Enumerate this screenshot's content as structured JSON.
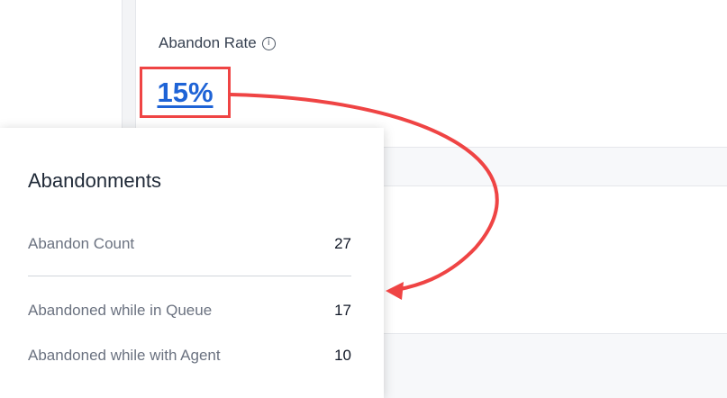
{
  "metric": {
    "title": "Abandon Rate",
    "value": "15%",
    "info_symbol": "i"
  },
  "popup": {
    "title": "Abandonments",
    "rows": [
      {
        "label": "Abandon Count",
        "value": "27"
      },
      {
        "label": "Abandoned while in Queue",
        "value": "17"
      },
      {
        "label": "Abandoned while with Agent",
        "value": "10"
      }
    ]
  },
  "annotation": {
    "highlight_color": "#ef4444",
    "arrow_color": "#ef4444",
    "link_color": "#1e63d6"
  }
}
